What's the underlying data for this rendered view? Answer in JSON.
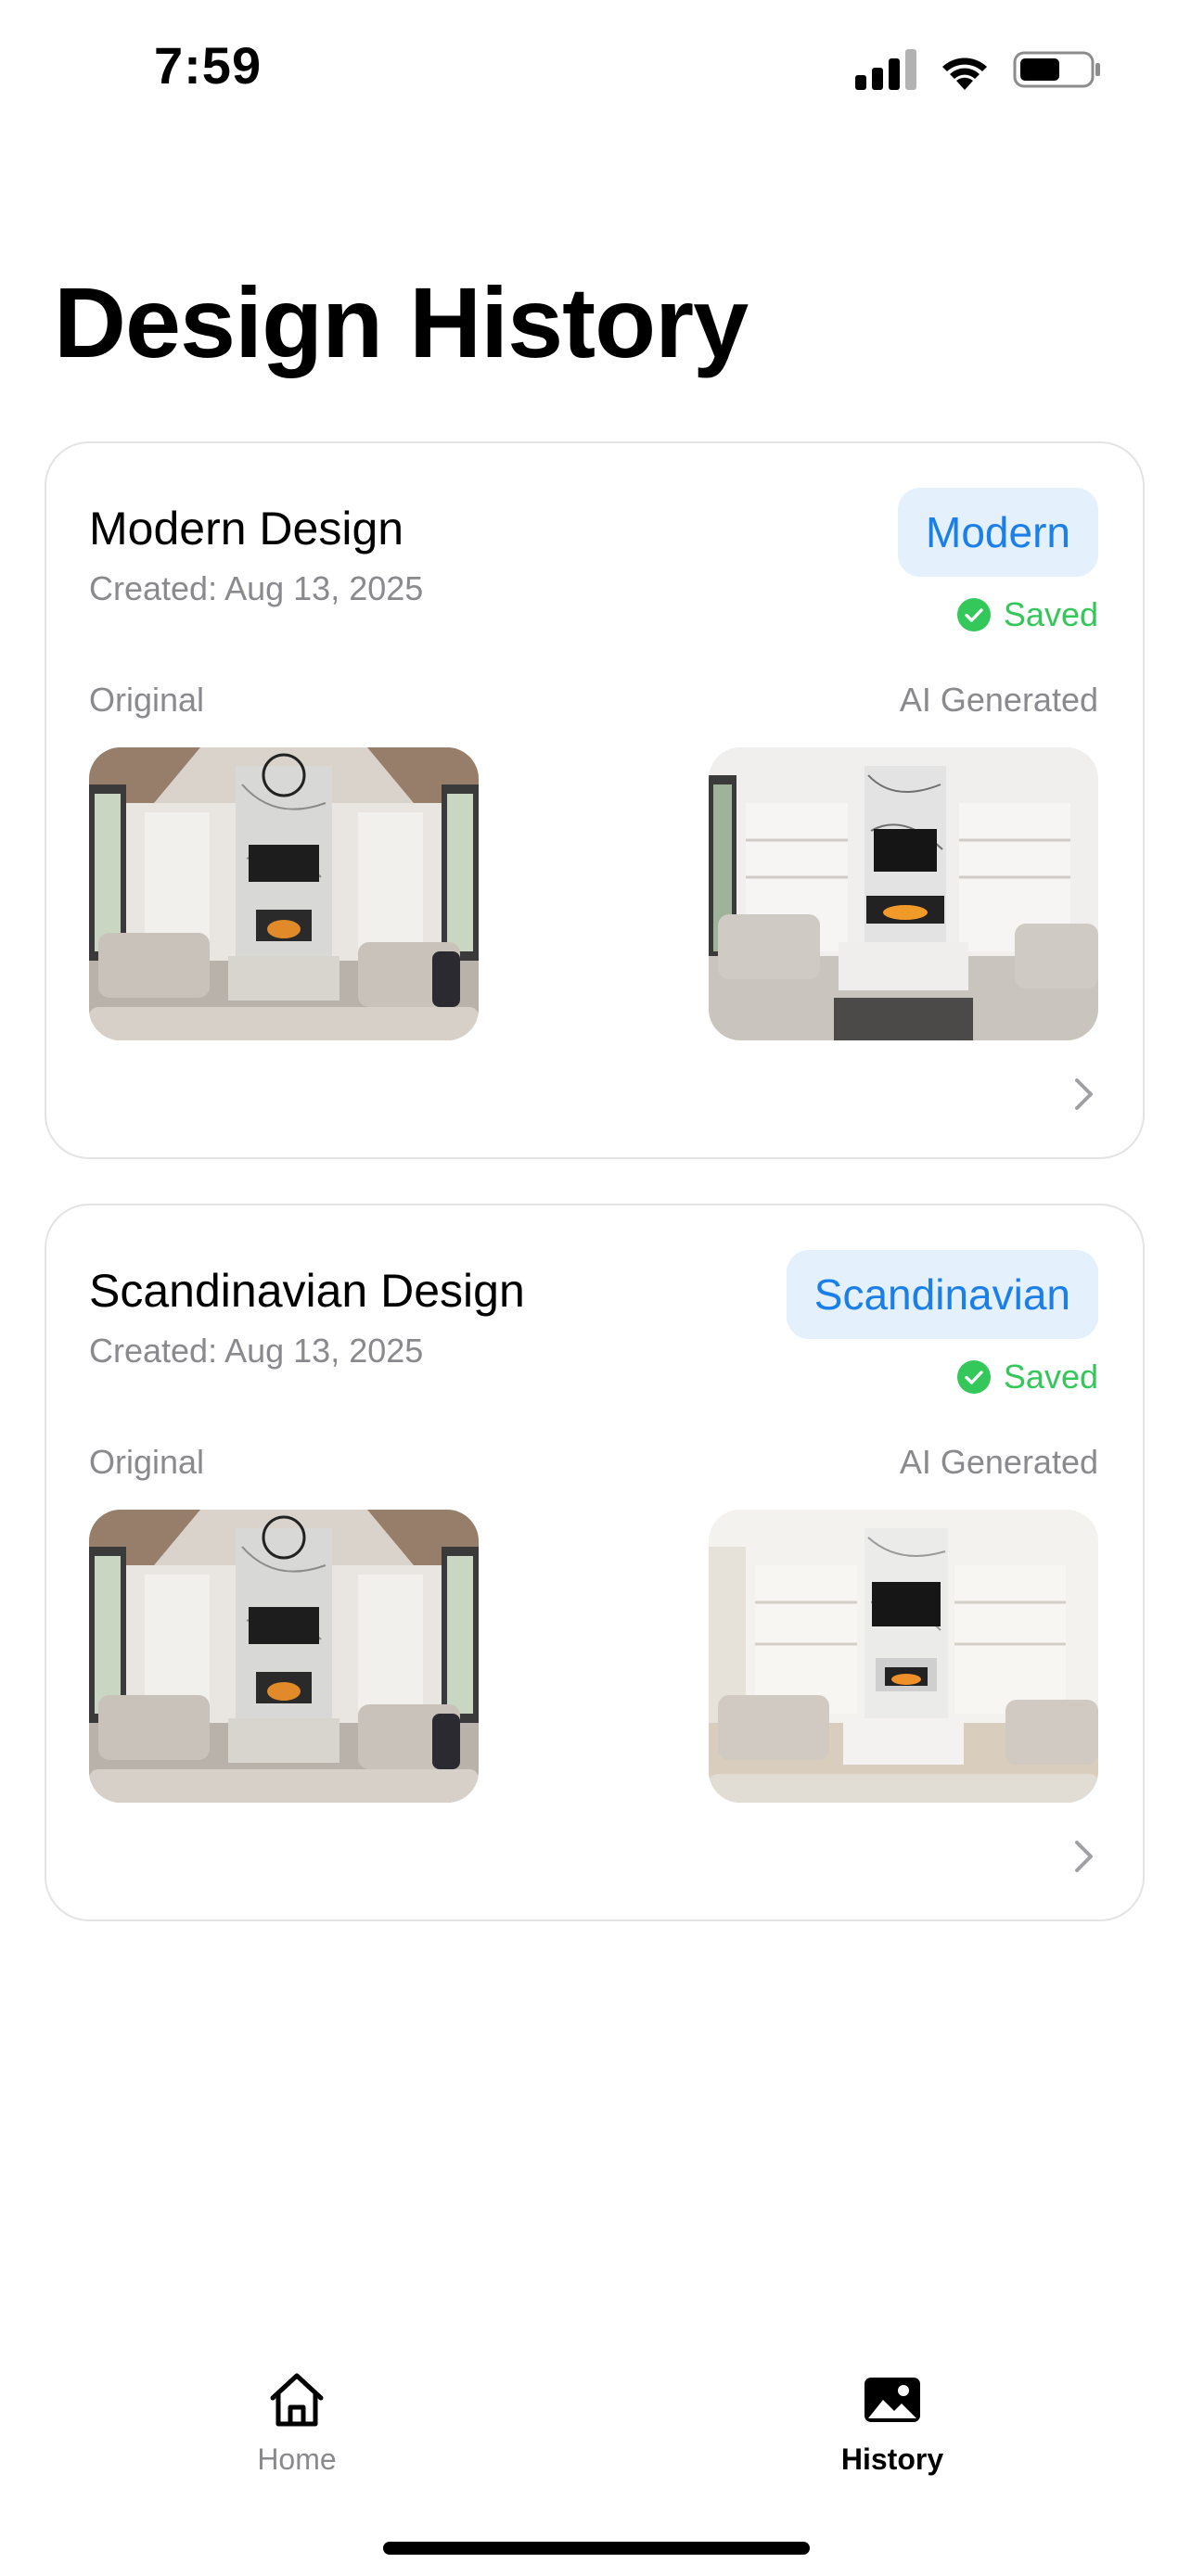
{
  "status_bar": {
    "time": "7:59",
    "icons": [
      "cellular-signal-icon",
      "wifi-icon",
      "battery-icon"
    ]
  },
  "page": {
    "title": "Design History"
  },
  "designs": [
    {
      "title": "Modern Design",
      "created": "Created: Aug 13, 2025",
      "style_badge": "Modern",
      "saved_label": "Saved",
      "original_label": "Original",
      "ai_label": "AI Generated"
    },
    {
      "title": "Scandinavian Design",
      "created": "Created: Aug 13, 2025",
      "style_badge": "Scandinavian",
      "saved_label": "Saved",
      "original_label": "Original",
      "ai_label": "AI Generated"
    }
  ],
  "tab_bar": {
    "tabs": [
      {
        "label": "Home",
        "icon": "house-icon",
        "active": false
      },
      {
        "label": "History",
        "icon": "photo-icon",
        "active": true
      }
    ]
  },
  "colors": {
    "accent": "#1a7fe8",
    "badge_bg": "#e4f0fc",
    "saved": "#34c759",
    "secondary_text": "#8a8a8e"
  }
}
